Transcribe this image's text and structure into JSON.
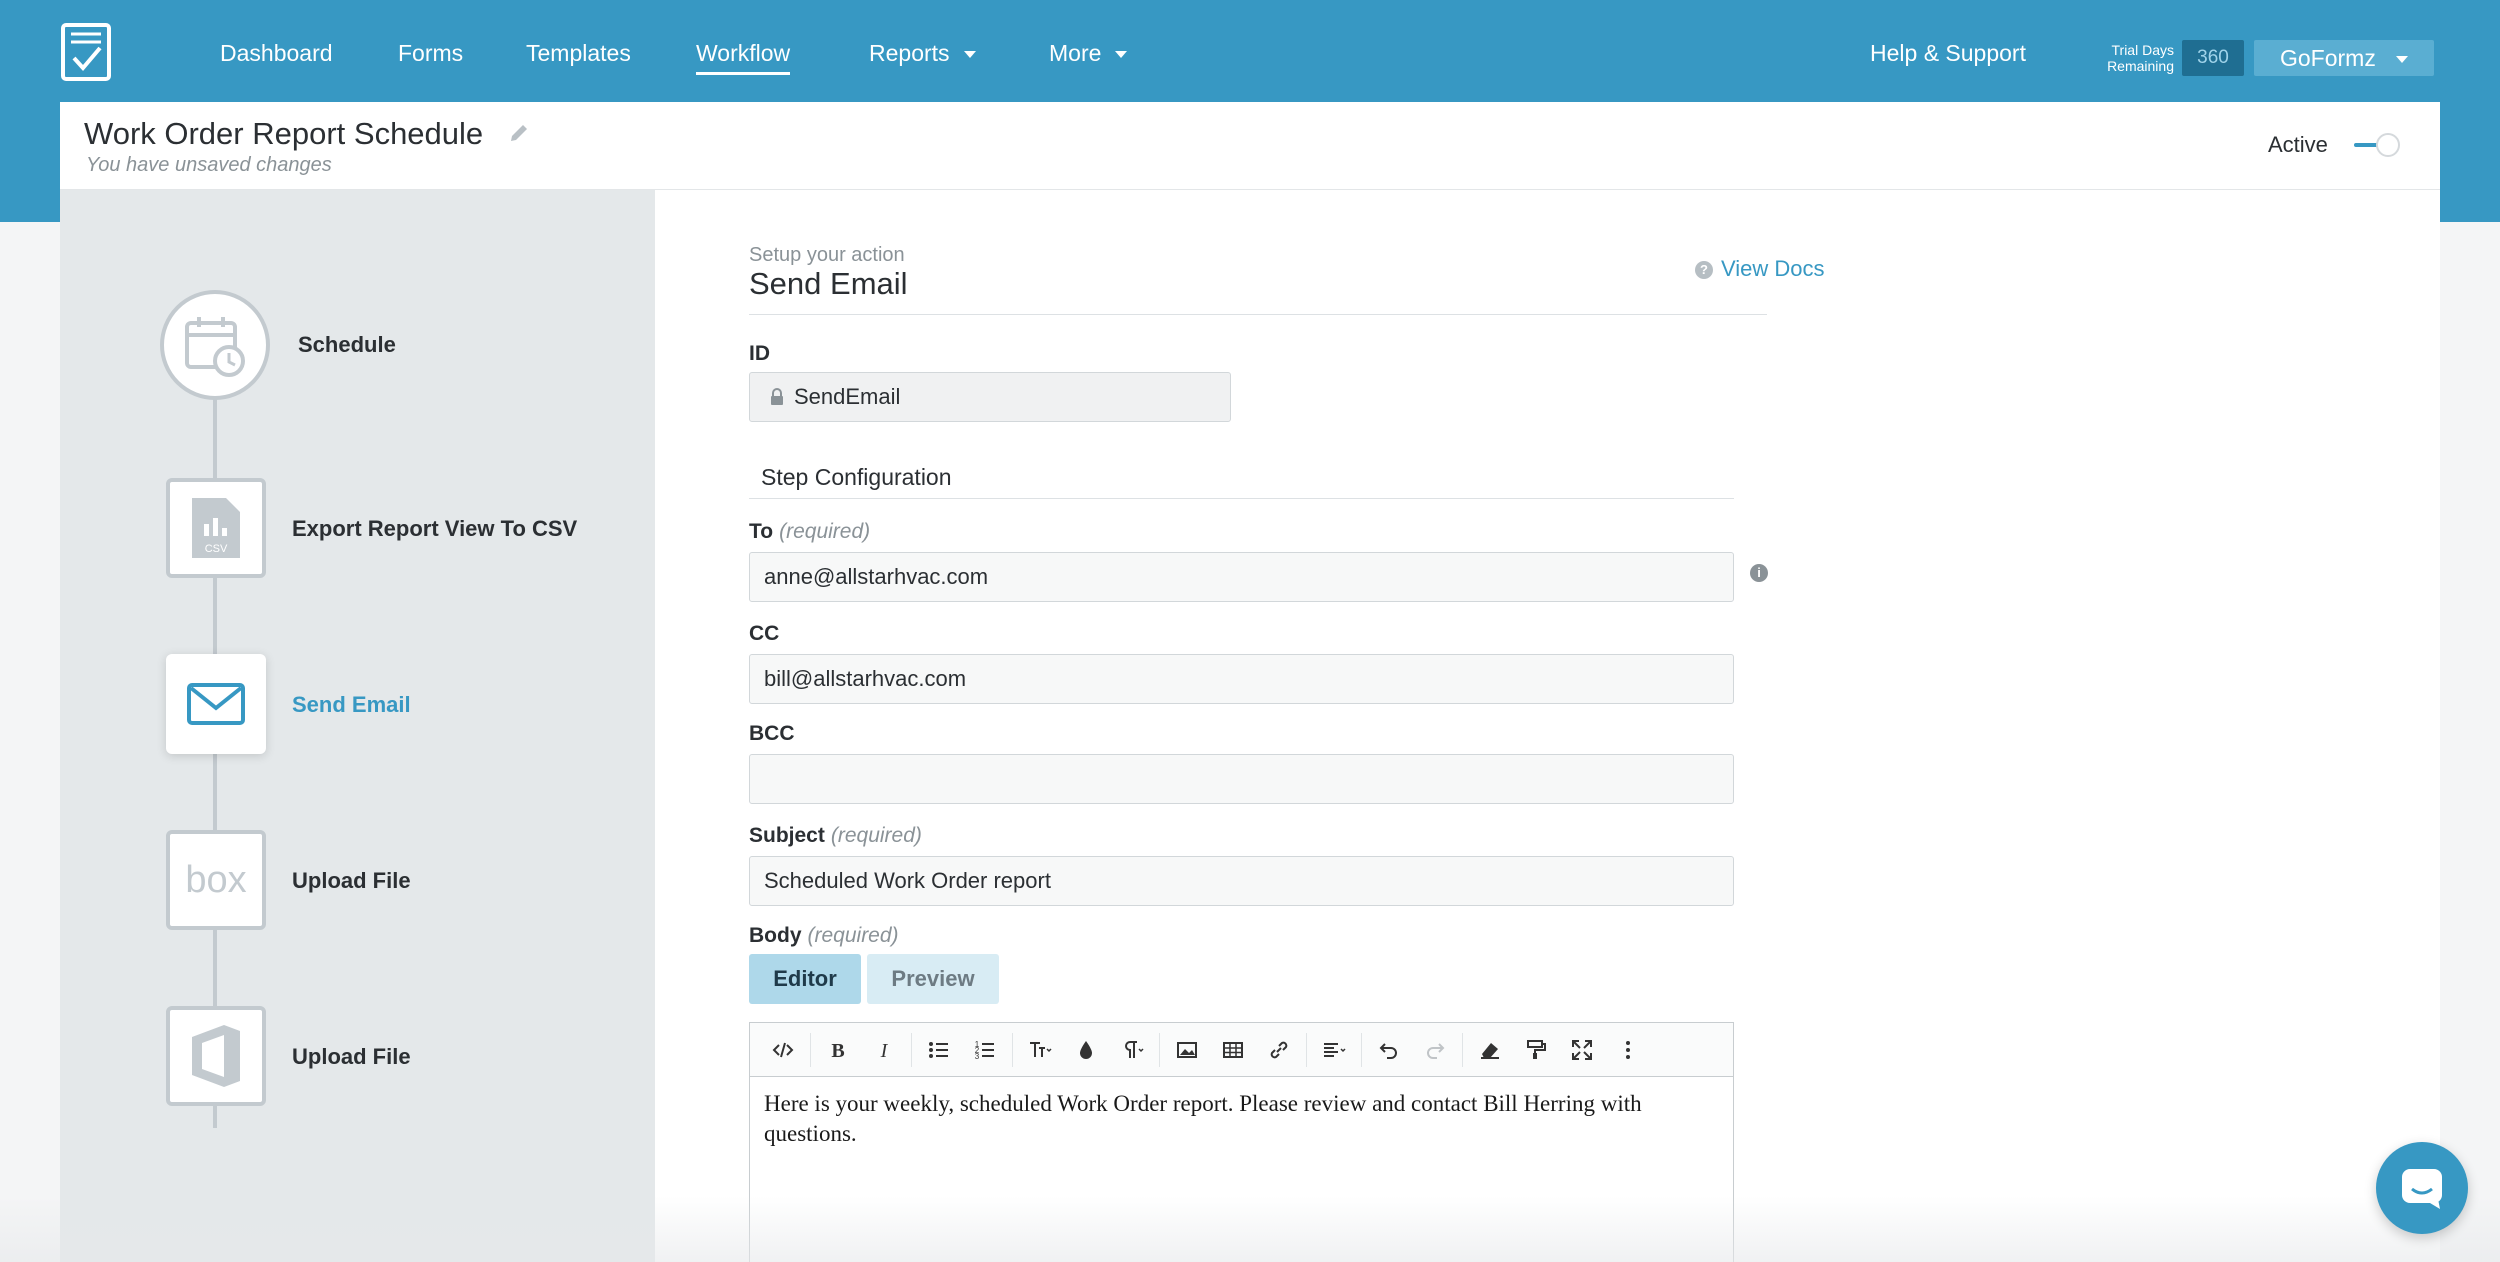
{
  "nav": {
    "items": [
      {
        "label": "Dashboard"
      },
      {
        "label": "Forms"
      },
      {
        "label": "Templates"
      },
      {
        "label": "Workflow",
        "active": true
      },
      {
        "label": "Reports",
        "dropdown": true
      },
      {
        "label": "More",
        "dropdown": true
      }
    ],
    "help": "Help & Support",
    "trial_line1": "Trial Days",
    "trial_line2": "Remaining",
    "trial_count": "360",
    "account": "GoFormz"
  },
  "header": {
    "title": "Work Order Report Schedule",
    "unsaved": "You have unsaved changes",
    "active_label": "Active",
    "active": true
  },
  "steps": [
    {
      "label": "Schedule",
      "icon": "calendar-clock-icon"
    },
    {
      "label": "Export Report View To CSV",
      "icon": "csv-file-icon",
      "icon_text": "CSV"
    },
    {
      "label": "Send Email",
      "icon": "envelope-icon",
      "selected": true
    },
    {
      "label": "Upload File",
      "icon": "box-logo-icon",
      "icon_text": "box"
    },
    {
      "label": "Upload File",
      "icon": "office-logo-icon"
    }
  ],
  "form": {
    "setup_label": "Setup your action",
    "action_title": "Send Email",
    "view_docs": "View Docs",
    "id_label": "ID",
    "id_value": "SendEmail",
    "section_title": "Step Configuration",
    "required": "(required)",
    "to_label": "To",
    "to_value": "anne@allstarhvac.com",
    "cc_label": "CC",
    "cc_value": "bill@allstarhvac.com",
    "bcc_label": "BCC",
    "bcc_value": "",
    "subject_label": "Subject",
    "subject_value": "Scheduled Work Order report",
    "body_label": "Body",
    "tab_editor": "Editor",
    "tab_preview": "Preview",
    "body_text": "Here is your weekly, scheduled Work Order report. Please review and contact Bill Herring with questions."
  },
  "colors": {
    "brand": "#3798c3",
    "sidebar": "#e4e8ea",
    "line": "#c3cacf"
  }
}
